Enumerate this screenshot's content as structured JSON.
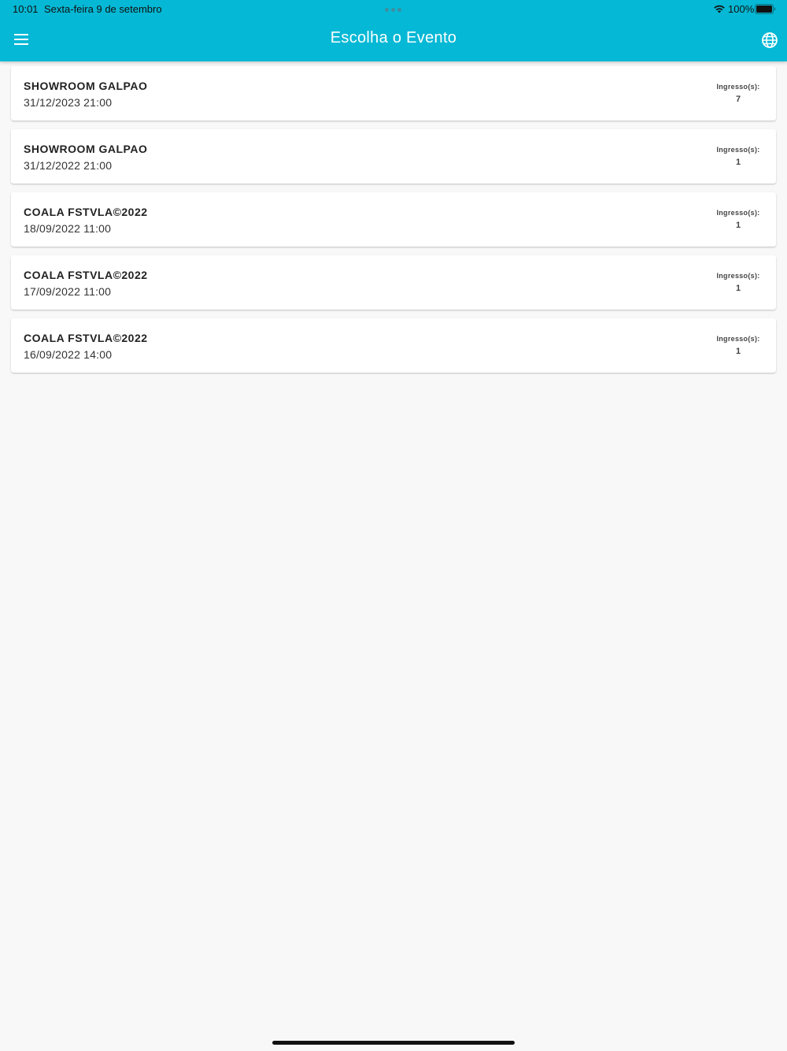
{
  "status_bar": {
    "time": "10:01",
    "date": "Sexta-feira 9 de setembro",
    "battery": "100%"
  },
  "header": {
    "title": "Escolha o Evento",
    "menu_icon": "hamburger-menu-icon",
    "language_icon": "globe-icon",
    "background_color": "#05b8d5"
  },
  "events": [
    {
      "name": "SHOWROOM GALPAO",
      "date": "31/12/2023 21:00",
      "tickets_label": "Ingresso(s):",
      "tickets": "7"
    },
    {
      "name": "SHOWROOM GALPAO",
      "date": "31/12/2022 21:00",
      "tickets_label": "Ingresso(s):",
      "tickets": "1"
    },
    {
      "name": "COALA FSTVLA©2022",
      "date": "18/09/2022 11:00",
      "tickets_label": "Ingresso(s):",
      "tickets": "1"
    },
    {
      "name": "COALA FSTVLA©2022",
      "date": "17/09/2022 11:00",
      "tickets_label": "Ingresso(s):",
      "tickets": "1"
    },
    {
      "name": "COALA FSTVLA©2022",
      "date": "16/09/2022 14:00",
      "tickets_label": "Ingresso(s):",
      "tickets": "1"
    }
  ]
}
